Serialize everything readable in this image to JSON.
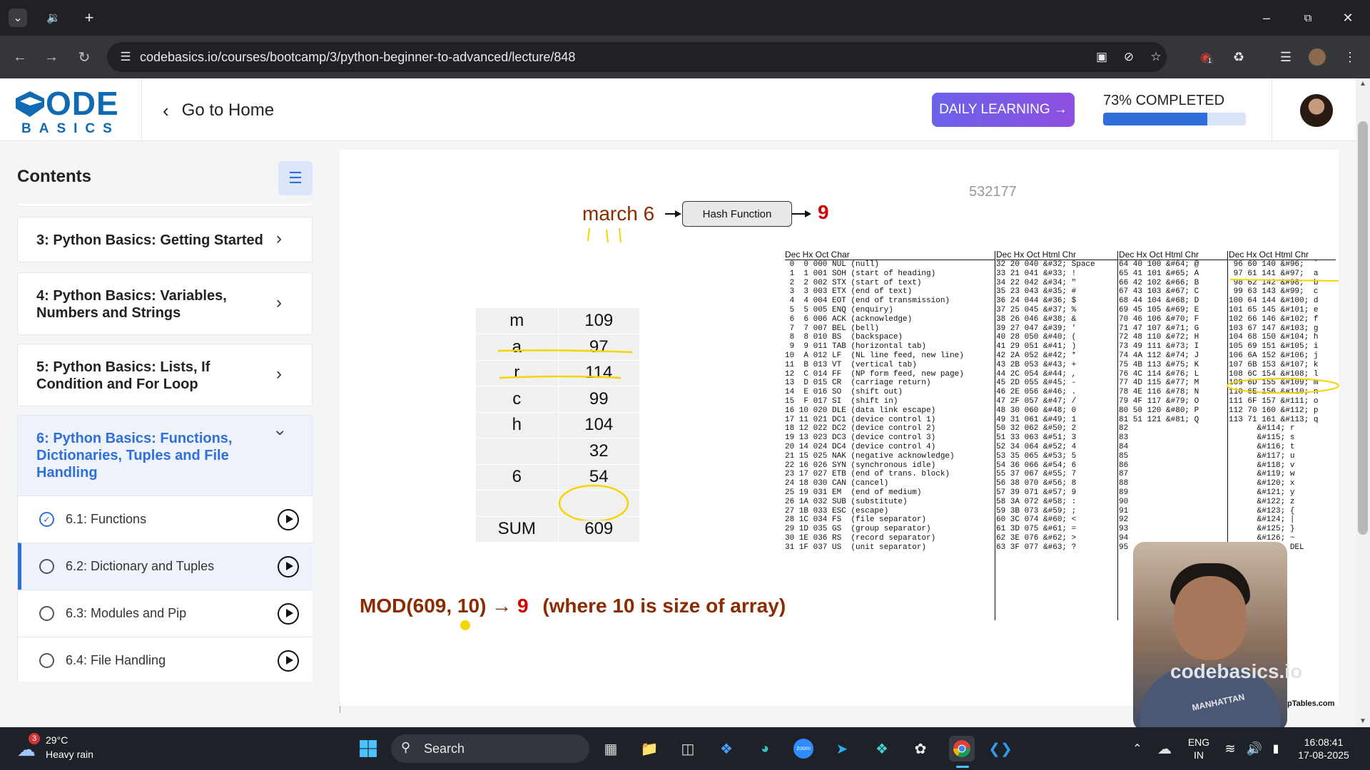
{
  "browser": {
    "url": "codebasics.io/courses/bootcamp/3/python-beginner-to-advanced/lecture/848",
    "extension_badge": "1"
  },
  "header": {
    "logo_top": "ODE",
    "logo_bottom": "BASICS",
    "go_home": "Go to Home",
    "daily_learning": "DAILY LEARNING →",
    "progress_label": "73% COMPLETED",
    "progress_fraction": 0.73
  },
  "sidebar": {
    "title": "Contents",
    "modules": [
      {
        "label": "3: Python Basics: Getting Started"
      },
      {
        "label": "4: Python Basics: Variables, Numbers and Strings"
      },
      {
        "label": "5: Python Basics: Lists, If Condition and For Loop"
      },
      {
        "label": "6: Python Basics: Functions, Dictionaries, Tuples and File Handling"
      }
    ],
    "lessons": [
      {
        "label": "6.1: Functions"
      },
      {
        "label": "6.2: Dictionary and Tuples"
      },
      {
        "label": "6.3: Modules and Pip"
      },
      {
        "label": "6.4: File Handling"
      }
    ]
  },
  "video": {
    "watermark_id": "532177",
    "key": "march 6",
    "hash_function": "Hash Function",
    "hash_result": "9",
    "table": [
      [
        "m",
        "109"
      ],
      [
        "a",
        "97"
      ],
      [
        "r",
        "114"
      ],
      [
        "c",
        "99"
      ],
      [
        "h",
        "104"
      ],
      [
        "",
        "32"
      ],
      [
        "6",
        "54"
      ],
      [
        "",
        ""
      ],
      [
        "SUM",
        "609"
      ]
    ],
    "mod_prefix": "MOD(609, 10) →",
    "mod_result": "9",
    "mod_note": "(where 10 is size of array)",
    "brand_watermark": "codebasics.io",
    "ascii_headers": [
      "Dec  Hx Oct  Char",
      "Dec  Hx Oct  Html  Chr",
      "Dec  Hx Oct  Html  Chr",
      "Dec  Hx Oct  Html Chr"
    ],
    "ascii_col1": " 0  0 000 NUL (null)\n 1  1 001 SOH (start of heading)\n 2  2 002 STX (start of text)\n 3  3 003 ETX (end of text)\n 4  4 004 EOT (end of transmission)\n 5  5 005 ENQ (enquiry)\n 6  6 006 ACK (acknowledge)\n 7  7 007 BEL (bell)\n 8  8 010 BS  (backspace)\n 9  9 011 TAB (horizontal tab)\n10  A 012 LF  (NL line feed, new line)\n11  B 013 VT  (vertical tab)\n12  C 014 FF  (NP form feed, new page)\n13  D 015 CR  (carriage return)\n14  E 016 SO  (shift out)\n15  F 017 SI  (shift in)\n16 10 020 DLE (data link escape)\n17 11 021 DC1 (device control 1)\n18 12 022 DC2 (device control 2)\n19 13 023 DC3 (device control 3)\n20 14 024 DC4 (device control 4)\n21 15 025 NAK (negative acknowledge)\n22 16 026 SYN (synchronous idle)\n23 17 027 ETB (end of trans. block)\n24 18 030 CAN (cancel)\n25 19 031 EM  (end of medium)\n26 1A 032 SUB (substitute)\n27 1B 033 ESC (escape)\n28 1C 034 FS  (file separator)\n29 1D 035 GS  (group separator)\n30 1E 036 RS  (record separator)\n31 1F 037 US  (unit separator)",
    "ascii_col2": "32 20 040 &#32; Space\n33 21 041 &#33; !\n34 22 042 &#34; \"\n35 23 043 &#35; #\n36 24 044 &#36; $\n37 25 045 &#37; %\n38 26 046 &#38; &\n39 27 047 &#39; '\n40 28 050 &#40; (\n41 29 051 &#41; )\n42 2A 052 &#42; *\n43 2B 053 &#43; +\n44 2C 054 &#44; ,\n45 2D 055 &#45; -\n46 2E 056 &#46; .\n47 2F 057 &#47; /\n48 30 060 &#48; 0\n49 31 061 &#49; 1\n50 32 062 &#50; 2\n51 33 063 &#51; 3\n52 34 064 &#52; 4\n53 35 065 &#53; 5\n54 36 066 &#54; 6\n55 37 067 &#55; 7\n56 38 070 &#56; 8\n57 39 071 &#57; 9\n58 3A 072 &#58; :\n59 3B 073 &#59; ;\n60 3C 074 &#60; <\n61 3D 075 &#61; =\n62 3E 076 &#62; >\n63 3F 077 &#63; ?",
    "ascii_col3": "64 40 100 &#64; @\n65 41 101 &#65; A\n66 42 102 &#66; B\n67 43 103 &#67; C\n68 44 104 &#68; D\n69 45 105 &#69; E\n70 46 106 &#70; F\n71 47 107 &#71; G\n72 48 110 &#72; H\n73 49 111 &#73; I\n74 4A 112 &#74; J\n75 4B 113 &#75; K\n76 4C 114 &#76; L\n77 4D 115 &#77; M\n78 4E 116 &#78; N\n79 4F 117 &#79; O\n80 50 120 &#80; P\n81 51 121 &#81; Q\n82\n83\n84\n85\n86\n87\n88\n89\n90\n91\n92\n93\n94\n95",
    "ascii_col4": " 96 60 140 &#96;  `\n 97 61 141 &#97;  a\n 98 62 142 &#98;  b\n 99 63 143 &#99;  c\n100 64 144 &#100; d\n101 65 145 &#101; e\n102 66 146 &#102; f\n103 67 147 &#103; g\n104 68 150 &#104; h\n105 69 151 &#105; i\n106 6A 152 &#106; j\n107 6B 153 &#107; k\n108 6C 154 &#108; l\n109 6D 155 &#109; m\n110 6E 156 &#110; n\n111 6F 157 &#111; o\n112 70 160 &#112; p\n113 71 161 &#113; q\n      &#114; r\n      &#115; s\n      &#116; t\n      &#117; u\n      &#118; v\n      &#119; w\n      &#120; x\n      &#121; y\n      &#122; z\n      &#123; {\n      &#124; |\n      &#125; }\n      &#126; ~\n      &#127; DEL",
    "ascii_source": "pTables.com",
    "webcam_shirt_text": "MANHATTAN"
  },
  "taskbar": {
    "weather_badge": "3",
    "temperature": "29°C",
    "weather": "Heavy rain",
    "search": "Search",
    "lang_top": "ENG",
    "lang_bottom": "IN",
    "time": "16:08:41",
    "date": "17-08-2025"
  },
  "colors": {
    "accent": "#2f6fdc",
    "video_red": "#d40000",
    "video_brown": "#8b2c00",
    "highlight": "#f5d400"
  }
}
